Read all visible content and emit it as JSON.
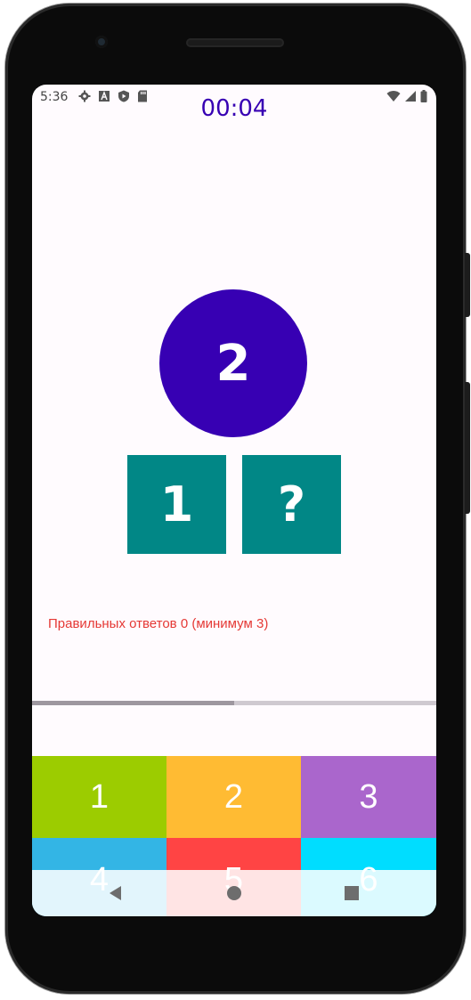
{
  "status_bar": {
    "time": "5:36",
    "left_icons": [
      "gear-icon",
      "font-icon",
      "shield-play-icon",
      "sd-card-icon"
    ],
    "right_icons": [
      "wifi-icon",
      "signal-icon",
      "battery-icon"
    ]
  },
  "game": {
    "timer": "00:04",
    "target_number": "2",
    "tiles": [
      "1",
      "?"
    ],
    "correct_answers_text": "Правильных ответов 0 (минимум 3)",
    "progress": 0.5
  },
  "keypad": {
    "keys": [
      {
        "label": "1",
        "color": "#9ccc00"
      },
      {
        "label": "2",
        "color": "#ffbb33"
      },
      {
        "label": "3",
        "color": "#aa66cc"
      },
      {
        "label": "4",
        "color": "#33b5e5"
      },
      {
        "label": "5",
        "color": "#ff4444"
      },
      {
        "label": "6",
        "color": "#00ddff"
      }
    ]
  },
  "nav_bar": {
    "buttons": [
      "back-icon",
      "home-icon",
      "recents-icon"
    ]
  },
  "colors": {
    "primary": "#3700b3",
    "tile": "#018786",
    "error_text": "#e53935"
  }
}
